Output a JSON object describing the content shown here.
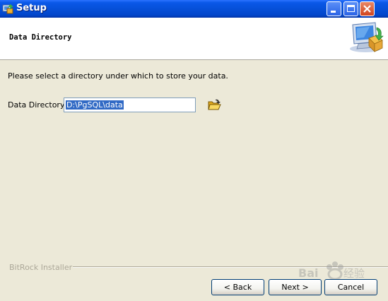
{
  "window": {
    "title": "Setup",
    "controls": {
      "minimize": "minimize-icon",
      "maximize": "maximize-icon",
      "close": "close-icon"
    }
  },
  "header": {
    "title": "Data Directory",
    "icon": "computer-install-icon"
  },
  "content": {
    "instruction": "Please select a directory under which to store your data.",
    "data_directory_label": "Data Directory",
    "data_directory_value": "D:\\PgSQL\\data",
    "browse_icon": "folder-open-icon"
  },
  "footer": {
    "brand": "BitRock Installer",
    "back_label": "< Back",
    "next_label": "Next >",
    "cancel_label": "Cancel"
  },
  "colors": {
    "titlebar": "#0650d8",
    "background": "#ece9d8",
    "selection": "#316ac5"
  }
}
